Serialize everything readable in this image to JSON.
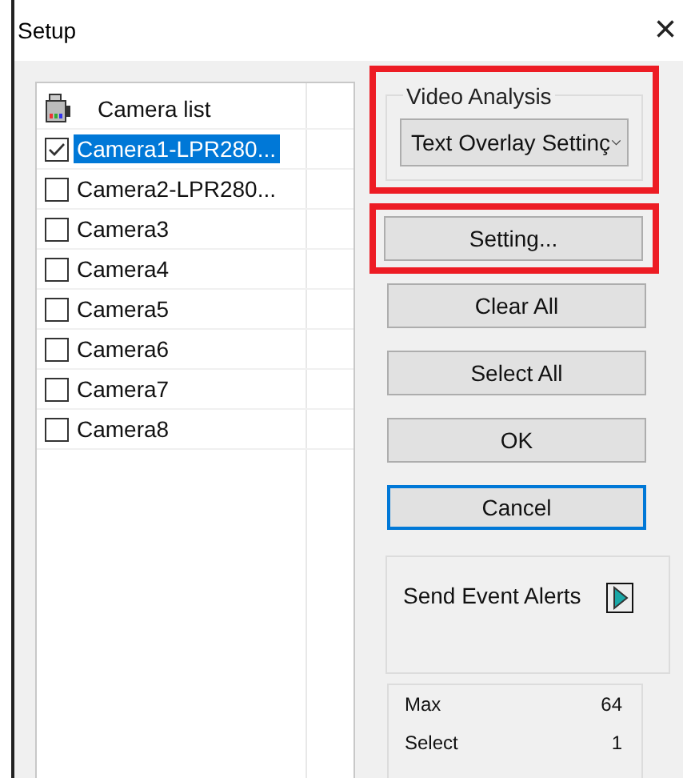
{
  "window": {
    "title": "Setup",
    "close": "×"
  },
  "camera_list": {
    "header": "Camera list",
    "items": [
      {
        "label": "Camera1-LPR280...",
        "checked": true,
        "selected": true
      },
      {
        "label": "Camera2-LPR280...",
        "checked": false,
        "selected": false
      },
      {
        "label": "Camera3",
        "checked": false,
        "selected": false
      },
      {
        "label": "Camera4",
        "checked": false,
        "selected": false
      },
      {
        "label": "Camera5",
        "checked": false,
        "selected": false
      },
      {
        "label": "Camera6",
        "checked": false,
        "selected": false
      },
      {
        "label": "Camera7",
        "checked": false,
        "selected": false
      },
      {
        "label": "Camera8",
        "checked": false,
        "selected": false
      }
    ]
  },
  "video_analysis": {
    "legend": "Video Analysis",
    "value": "Text Overlay Settinç",
    "highlighted": true
  },
  "buttons": [
    {
      "label": "Setting...",
      "focused": false,
      "highlighted": true
    },
    {
      "label": "Clear All",
      "focused": false,
      "highlighted": false
    },
    {
      "label": "Select All",
      "focused": false,
      "highlighted": false
    },
    {
      "label": "OK",
      "focused": false,
      "highlighted": false
    },
    {
      "label": "Cancel",
      "focused": true,
      "highlighted": false
    }
  ],
  "alerts": {
    "label": "Send Event Alerts"
  },
  "stats": [
    {
      "label": "Max",
      "value": "64"
    },
    {
      "label": "Select",
      "value": "1"
    }
  ]
}
